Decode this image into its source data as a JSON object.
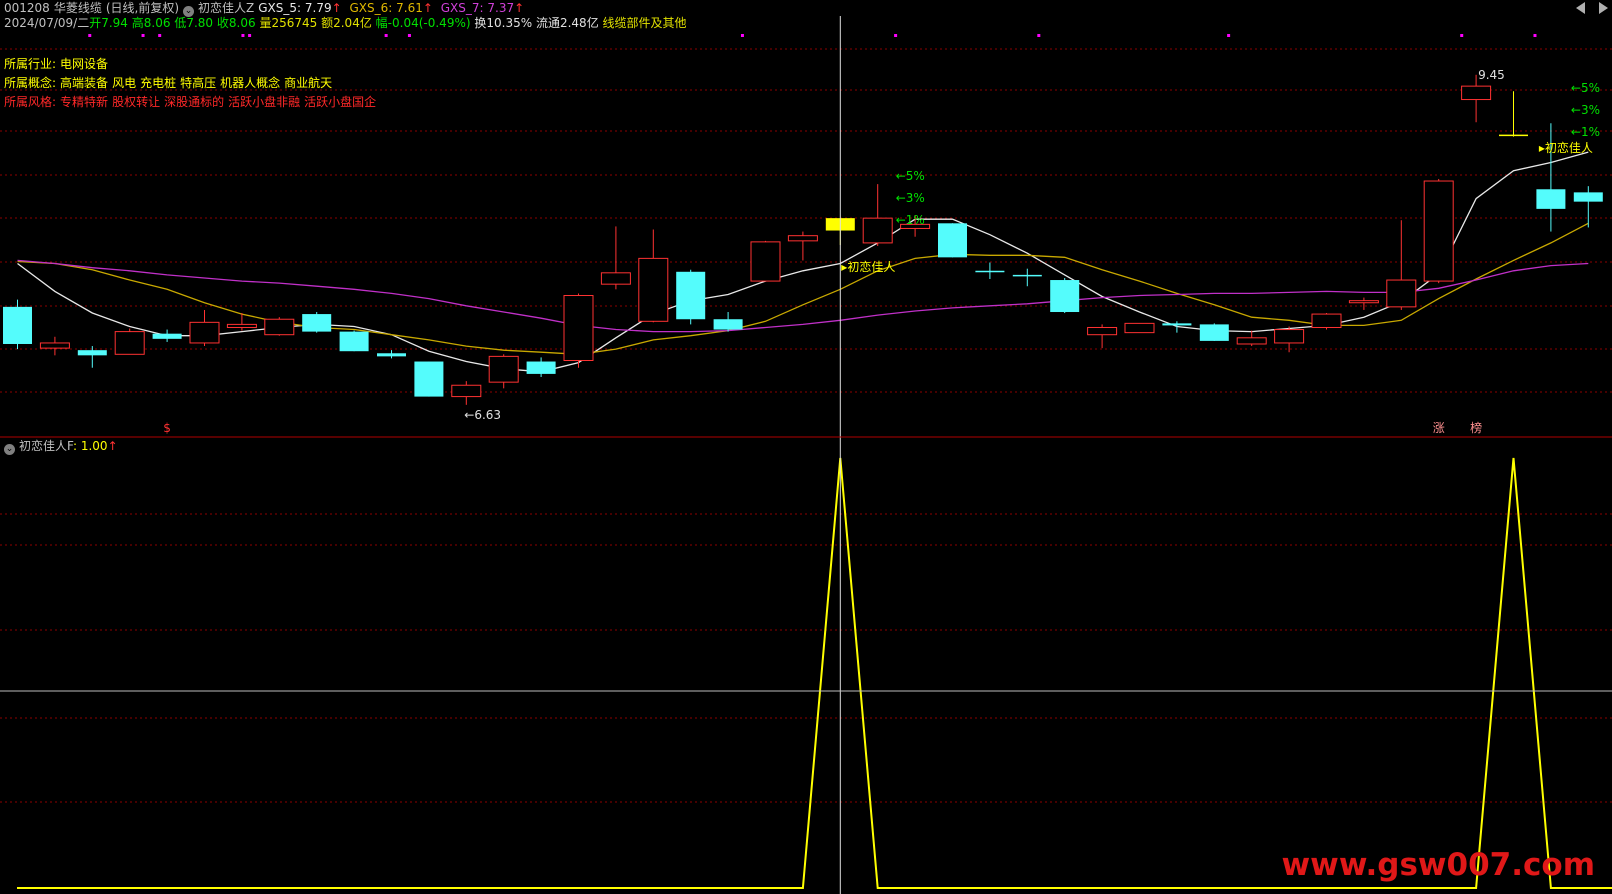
{
  "header": {
    "code": "001208",
    "name": "华菱线缆",
    "mode": "(日线,前复权)",
    "indicator": "初恋佳人Z",
    "ma5": "GXS_5: 7.79",
    "ma6": "GXS_6: 7.61",
    "ma7": "GXS_7: 7.37",
    "arrow": "↑"
  },
  "quote": {
    "date": "2024/07/09/二",
    "open": "开7.94",
    "high": "高8.06",
    "low": "低7.80",
    "close": "收8.06",
    "volume": "量256745",
    "amount": "额2.04亿",
    "change": "幅-0.04(-0.49%)",
    "turnover": "换10.35%",
    "float": "流通2.48亿",
    "sector": "线缆部件及其他"
  },
  "info": {
    "industry_label": "所属行业:",
    "industry": "电网设备",
    "concept_label": "所属概念:",
    "concepts": [
      "高端装备",
      "风电",
      "充电桩",
      "特高压",
      "机器人概念",
      "商业航天"
    ],
    "style_label": "所属风格:",
    "styles": [
      "专精特新",
      "股权转让",
      "深股通标的",
      "活跃小盘非融",
      "活跃小盘国企"
    ]
  },
  "lower_panel": {
    "title": "初恋佳人F",
    "value": ": 1.00",
    "arrow": "↑"
  },
  "watermark": "www.gsw007.com",
  "colors": {
    "up": "#ff3232",
    "down": "#54fcfc",
    "signal": "#ffff00",
    "ma5": "#e8e8e8",
    "ma6": "#c8a800",
    "ma7": "#c030c8",
    "grid": "#8b0000",
    "green": "#00e000",
    "magenta": "#ff00ff"
  },
  "chart_data": [
    {
      "type": "candlestick",
      "title": "001208 华菱线缆 (日线,前复权)",
      "ylim": [
        6.2,
        9.7
      ],
      "candles": [
        {
          "o": 7.2,
          "h": 7.27,
          "l": 6.79,
          "c": 6.84,
          "k": "down"
        },
        {
          "o": 6.8,
          "h": 6.91,
          "l": 6.73,
          "c": 6.85,
          "k": "up"
        },
        {
          "o": 6.78,
          "h": 6.82,
          "l": 6.61,
          "c": 6.73,
          "k": "down"
        },
        {
          "o": 6.74,
          "h": 6.99,
          "l": 6.74,
          "c": 6.96,
          "k": "up"
        },
        {
          "o": 6.94,
          "h": 6.98,
          "l": 6.86,
          "c": 6.89,
          "k": "down"
        },
        {
          "o": 6.85,
          "h": 7.17,
          "l": 6.82,
          "c": 7.05,
          "k": "up"
        },
        {
          "o": 7.0,
          "h": 7.14,
          "l": 6.97,
          "c": 7.03,
          "k": "up"
        },
        {
          "o": 6.93,
          "h": 7.1,
          "l": 6.92,
          "c": 7.08,
          "k": "up"
        },
        {
          "o": 7.13,
          "h": 7.15,
          "l": 6.95,
          "c": 6.96,
          "k": "down"
        },
        {
          "o": 6.96,
          "h": 6.97,
          "l": 6.77,
          "c": 6.77,
          "k": "down"
        },
        {
          "o": 6.75,
          "h": 6.78,
          "l": 6.7,
          "c": 6.72,
          "k": "down"
        },
        {
          "o": 6.67,
          "h": 6.67,
          "l": 6.33,
          "c": 6.33,
          "k": "down"
        },
        {
          "o": 6.33,
          "h": 6.48,
          "l": 6.25,
          "c": 6.44,
          "k": "up"
        },
        {
          "o": 6.47,
          "h": 6.74,
          "l": 6.41,
          "c": 6.72,
          "k": "up"
        },
        {
          "o": 6.67,
          "h": 6.71,
          "l": 6.52,
          "c": 6.55,
          "k": "down"
        },
        {
          "o": 6.68,
          "h": 7.33,
          "l": 6.61,
          "c": 7.31,
          "k": "up"
        },
        {
          "o": 7.42,
          "h": 7.98,
          "l": 7.37,
          "c": 7.53,
          "k": "up"
        },
        {
          "o": 7.06,
          "h": 7.95,
          "l": 7.05,
          "c": 7.67,
          "k": "up"
        },
        {
          "o": 7.54,
          "h": 7.56,
          "l": 7.03,
          "c": 7.08,
          "k": "down"
        },
        {
          "o": 7.08,
          "h": 7.15,
          "l": 6.96,
          "c": 6.98,
          "k": "down"
        },
        {
          "o": 7.45,
          "h": 7.84,
          "l": 7.45,
          "c": 7.83,
          "k": "up"
        },
        {
          "o": 7.84,
          "h": 7.93,
          "l": 7.65,
          "c": 7.89,
          "k": "up"
        },
        {
          "o": 7.94,
          "h": 8.06,
          "l": 7.8,
          "c": 8.06,
          "k": "signal"
        },
        {
          "o": 7.82,
          "h": 8.39,
          "l": 7.79,
          "c": 8.06,
          "k": "up"
        },
        {
          "o": 7.96,
          "h": 8.09,
          "l": 7.88,
          "c": 8.0,
          "k": "up"
        },
        {
          "o": 8.01,
          "h": 8.01,
          "l": 7.68,
          "c": 7.68,
          "k": "down"
        },
        {
          "o": 7.55,
          "h": 7.63,
          "l": 7.47,
          "c": 7.55,
          "k": "down"
        },
        {
          "o": 7.51,
          "h": 7.57,
          "l": 7.4,
          "c": 7.51,
          "k": "down"
        },
        {
          "o": 7.46,
          "h": 7.48,
          "l": 7.14,
          "c": 7.15,
          "k": "down"
        },
        {
          "o": 6.93,
          "h": 7.03,
          "l": 6.8,
          "c": 7.0,
          "k": "up"
        },
        {
          "o": 6.95,
          "h": 7.04,
          "l": 6.95,
          "c": 7.04,
          "k": "up"
        },
        {
          "o": 7.04,
          "h": 7.06,
          "l": 6.95,
          "c": 7.02,
          "k": "down"
        },
        {
          "o": 7.03,
          "h": 7.04,
          "l": 6.87,
          "c": 6.87,
          "k": "down"
        },
        {
          "o": 6.84,
          "h": 6.97,
          "l": 6.82,
          "c": 6.9,
          "k": "up"
        },
        {
          "o": 6.85,
          "h": 7.01,
          "l": 6.76,
          "c": 6.98,
          "k": "up"
        },
        {
          "o": 7.0,
          "h": 7.14,
          "l": 6.98,
          "c": 7.13,
          "k": "up"
        },
        {
          "o": 7.24,
          "h": 7.29,
          "l": 7.17,
          "c": 7.26,
          "k": "up"
        },
        {
          "o": 7.2,
          "h": 8.04,
          "l": 7.17,
          "c": 7.46,
          "k": "up"
        },
        {
          "o": 7.45,
          "h": 8.44,
          "l": 7.43,
          "c": 8.42,
          "k": "up"
        },
        {
          "o": 9.21,
          "h": 9.45,
          "l": 8.99,
          "c": 9.34,
          "k": "up"
        },
        {
          "o": 8.87,
          "h": 9.29,
          "l": 8.85,
          "c": 8.87,
          "k": "signal"
        },
        {
          "o": 8.34,
          "h": 8.98,
          "l": 7.93,
          "c": 8.15,
          "k": "down"
        },
        {
          "o": 8.31,
          "h": 8.37,
          "l": 7.97,
          "c": 8.22,
          "k": "down"
        }
      ],
      "series": [
        {
          "name": "GXS_5",
          "color": "#e8e8e8",
          "values": [
            7.62,
            7.35,
            7.14,
            7.01,
            6.92,
            6.92,
            6.96,
            7.0,
            7.03,
            7.01,
            6.93,
            6.77,
            6.67,
            6.6,
            6.57,
            6.66,
            6.9,
            7.13,
            7.26,
            7.32,
            7.45,
            7.55,
            7.62,
            7.82,
            8.05,
            8.05,
            7.9,
            7.72,
            7.51,
            7.3,
            7.15,
            7.01,
            6.97,
            6.96,
            6.99,
            7.02,
            7.1,
            7.25,
            7.52,
            8.25,
            8.52,
            8.6,
            8.7
          ]
        },
        {
          "name": "GXS_6",
          "color": "#c8a800",
          "values": [
            7.64,
            7.62,
            7.56,
            7.46,
            7.37,
            7.24,
            7.13,
            7.05,
            7.0,
            6.98,
            6.93,
            6.88,
            6.82,
            6.78,
            6.76,
            6.74,
            6.79,
            6.88,
            6.92,
            6.97,
            7.06,
            7.22,
            7.37,
            7.55,
            7.67,
            7.71,
            7.7,
            7.7,
            7.68,
            7.56,
            7.45,
            7.33,
            7.22,
            7.1,
            7.07,
            7.02,
            7.02,
            7.07,
            7.28,
            7.47,
            7.65,
            7.82,
            8.01
          ]
        },
        {
          "name": "GXS_7",
          "color": "#c030c8",
          "values": [
            7.65,
            7.62,
            7.58,
            7.55,
            7.51,
            7.48,
            7.45,
            7.43,
            7.4,
            7.37,
            7.33,
            7.28,
            7.21,
            7.15,
            7.09,
            7.02,
            6.98,
            6.96,
            6.96,
            6.97,
            7.0,
            7.03,
            7.07,
            7.12,
            7.16,
            7.19,
            7.21,
            7.23,
            7.26,
            7.29,
            7.31,
            7.32,
            7.33,
            7.33,
            7.34,
            7.35,
            7.34,
            7.34,
            7.38,
            7.46,
            7.55,
            7.6,
            7.62
          ]
        }
      ],
      "annotations": [
        "←6.63",
        "9.45",
        "←5%",
        "←3%",
        "←1%",
        "初恋佳人",
        "$",
        "涨",
        "榜"
      ],
      "low_marker": {
        "index": 12,
        "text": "←6.63"
      },
      "high_marker": {
        "index": 39,
        "text": "9.45"
      },
      "signal_labels": [
        {
          "index": 22,
          "text": "初恋佳人"
        },
        {
          "index": 41,
          "text": "初恋佳人"
        }
      ],
      "pct_targets": [
        {
          "index": 23,
          "labels": [
            "←5%",
            "←3%",
            "←1%"
          ]
        },
        {
          "index": 41,
          "labels": [
            "←5%",
            "←3%",
            "←1%"
          ]
        }
      ],
      "bottom_marks": [
        {
          "index": 4,
          "text": "$"
        },
        {
          "index": 38,
          "text": "涨"
        },
        {
          "index": 39,
          "text": "榜"
        }
      ],
      "crosshair_index": 22
    },
    {
      "type": "line",
      "title": "初恋佳人F",
      "ylim": [
        0,
        1
      ],
      "series": [
        {
          "name": "初恋佳人F",
          "color": "#ffff00",
          "values": [
            0,
            0,
            0,
            0,
            0,
            0,
            0,
            0,
            0,
            0,
            0,
            0,
            0,
            0,
            0,
            0,
            0,
            0,
            0,
            0,
            0,
            0,
            1,
            0,
            0,
            0,
            0,
            0,
            0,
            0,
            0,
            0,
            0,
            0,
            0,
            0,
            0,
            0,
            0,
            0,
            1,
            0,
            0
          ]
        }
      ]
    }
  ]
}
